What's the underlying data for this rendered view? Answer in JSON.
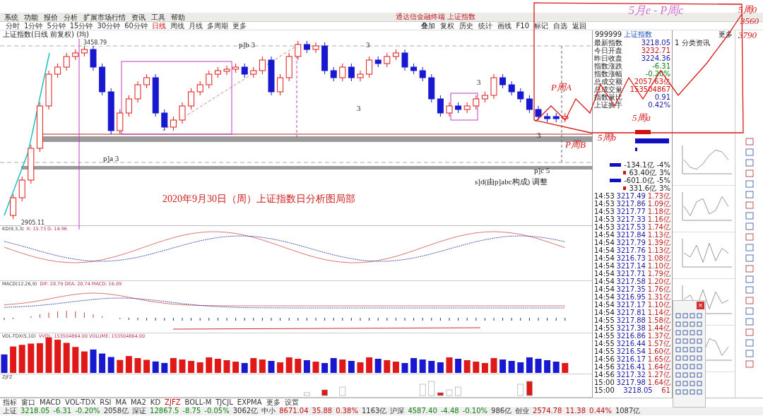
{
  "menu": [
    "系统",
    "功能",
    "报价",
    "分析",
    "扩展市场行情",
    "资讯",
    "工具",
    "帮助"
  ],
  "window_title": "通达信金融终端 上证指数",
  "period_tabs": [
    {
      "label": "分时",
      "selected": false
    },
    {
      "label": "1分钟",
      "selected": false
    },
    {
      "label": "5分钟",
      "selected": false
    },
    {
      "label": "15分钟",
      "selected": false
    },
    {
      "label": "30分钟",
      "selected": false
    },
    {
      "label": "60分钟",
      "selected": false
    },
    {
      "label": "日线",
      "selected": true
    },
    {
      "label": "周线",
      "selected": false
    },
    {
      "label": "月线",
      "selected": false
    },
    {
      "label": "多周期",
      "selected": false
    },
    {
      "label": "更多",
      "selected": false
    }
  ],
  "toolbar_buttons": [
    "叠加",
    "复权",
    "历史",
    "统计",
    "画线",
    "F10",
    "标记",
    "自选",
    "返回"
  ],
  "chart": {
    "title": "上证指数(日线 前复权) (均)",
    "high_label": "3458.79",
    "low_label": "2905.11",
    "wave_labels": [
      "p]b 3",
      "3",
      "3",
      "3",
      "p]a 3",
      "p]c 5",
      "3"
    ],
    "caption": "2020年9月30日（周）上证指数日分析图局部",
    "note": "s]d(由p]abc构成) 调整"
  },
  "indicators": [
    {
      "kind": "kd",
      "name": "KD(9,3,3)",
      "values": "K: 15.73  D: 14.96"
    },
    {
      "kind": "macd",
      "name": "MACD(12,26,9)",
      "values": "DIF: 28.79  DEA: 20.74  MACD: 16.09"
    },
    {
      "kind": "vol",
      "name": "VOL-TDX(5,10)",
      "values": "VVOL: 153504864.00  VOLUME: 153504864.00"
    },
    {
      "kind": "zjfz",
      "name": "ZJFZ"
    }
  ],
  "quote": {
    "code": "999999",
    "name": "上证指数",
    "rows": [
      {
        "label": "最新指数",
        "value": "3218.05",
        "color": "#1a1aa6"
      },
      {
        "label": "今日开盘",
        "value": "3232.71",
        "color": "#d01010"
      },
      {
        "label": "昨日收盘",
        "value": "3224.36",
        "color": "#1a1aa6"
      },
      {
        "label": "指数涨跌",
        "value": "-6.31",
        "color": "#108010"
      },
      {
        "label": "指数涨幅",
        "value": "-0.20%",
        "color": "#108010"
      },
      {
        "label": "总成交额",
        "value": "2057.63亿",
        "color": "#d01010"
      },
      {
        "label": "总成交量",
        "value": "153504867",
        "color": "#d01010"
      },
      {
        "label": "指数量比",
        "value": "0.91",
        "color": "#1a1aa6"
      },
      {
        "label": "上证换手",
        "value": "0.42%",
        "color": "#1a1aa6"
      }
    ],
    "flows": [
      {
        "value": "-134.1亿",
        "pct": "-4%",
        "color": "#1010c0"
      },
      {
        "value": "63.40亿",
        "pct": "3%",
        "color": "#d01010"
      },
      {
        "value": "-601.0亿",
        "pct": "-5%",
        "color": "#1010c0"
      },
      {
        "value": "331.6亿",
        "pct": "3%",
        "color": "#d01010"
      }
    ]
  },
  "ticks": [
    {
      "time": "14:53",
      "price": "3217.49",
      "amount": "1.73亿"
    },
    {
      "time": "14:53",
      "price": "3217.86",
      "amount": "1.09亿"
    },
    {
      "time": "14:53",
      "price": "3217.77",
      "amount": "1.18亿"
    },
    {
      "time": "14:53",
      "price": "3217.33",
      "amount": "1.16亿"
    },
    {
      "time": "14:53",
      "price": "3217.53",
      "amount": "1.74亿"
    },
    {
      "time": "14:54",
      "price": "3217.84",
      "amount": "1.13亿"
    },
    {
      "time": "14:54",
      "price": "3217.79",
      "amount": "1.39亿"
    },
    {
      "time": "14:54",
      "price": "3217.76",
      "amount": "1.13亿"
    },
    {
      "time": "14:54",
      "price": "3216.73",
      "amount": "1.08亿"
    },
    {
      "time": "14:54",
      "price": "3217.14",
      "amount": "1.10亿"
    },
    {
      "time": "14:54",
      "price": "3217.71",
      "amount": "1.79亿"
    },
    {
      "time": "14:54",
      "price": "3217.58",
      "amount": "1.20亿"
    },
    {
      "time": "14:54",
      "price": "3217.35",
      "amount": "1.76亿"
    },
    {
      "time": "14:54",
      "price": "3216.95",
      "amount": "1.31亿"
    },
    {
      "time": "14:54",
      "price": "3217.17",
      "amount": "1.10亿"
    },
    {
      "time": "14:54",
      "price": "3217.81",
      "amount": "1.14亿"
    },
    {
      "time": "14:55",
      "price": "3217.88",
      "amount": "1.58亿"
    },
    {
      "time": "14:55",
      "price": "3217.38",
      "amount": "1.44亿"
    },
    {
      "time": "14:55",
      "price": "3216.86",
      "amount": "1.37亿"
    },
    {
      "time": "14:55",
      "price": "3216.44",
      "amount": "1.57亿"
    },
    {
      "time": "14:55",
      "price": "3216.54",
      "amount": "1.60亿"
    },
    {
      "time": "14:56",
      "price": "3216.17",
      "amount": "1.65亿"
    },
    {
      "time": "14:56",
      "price": "3216.41",
      "amount": "1.64亿"
    },
    {
      "time": "14:56",
      "price": "3217.32",
      "amount": "1.27亿"
    },
    {
      "time": "15:00",
      "price": "3217.98",
      "amount": "1.64亿"
    },
    {
      "time": "15:00",
      "price": "3218.05",
      "amount": "61"
    }
  ],
  "news": {
    "more": "更多",
    "category": "1 分类资讯"
  },
  "palette": {
    "close": "×"
  },
  "bottom_tabs": [
    {
      "label": "指标",
      "selected": false
    },
    {
      "label": "窗口",
      "selected": false
    },
    {
      "label": "MACD",
      "selected": false
    },
    {
      "label": "VOL-TDX",
      "selected": false
    },
    {
      "label": "RSI",
      "selected": false
    },
    {
      "label": "MA",
      "selected": false
    },
    {
      "label": "MA2",
      "selected": false
    },
    {
      "label": "KD",
      "selected": false
    },
    {
      "label": "ZJFZ",
      "selected": true
    },
    {
      "label": "BOLL-M",
      "selected": false
    },
    {
      "label": "TJCJL",
      "selected": false
    },
    {
      "label": "EXPMA",
      "selected": false
    },
    {
      "label": "更多",
      "selected": false
    },
    {
      "label": "设置",
      "selected": false
    }
  ],
  "status": [
    {
      "name": "上证",
      "value": "3218.05",
      "change": "-6.31",
      "pct": "-0.20%",
      "amount": "2058亿"
    },
    {
      "name": "深证",
      "value": "12867.5",
      "change": "-8.75",
      "pct": "-0.05%",
      "amount": "3062亿"
    },
    {
      "name": "中小",
      "value": "8671.04",
      "change": "35.88",
      "pct": "0.38%",
      "amount": "1163亿"
    },
    {
      "name": "沪深",
      "value": "4587.40",
      "change": "-4.48",
      "pct": "-0.10%",
      "amount": "986亿"
    },
    {
      "name": "创业",
      "value": "2574.78",
      "change": "11.38",
      "pct": "0.44%",
      "amount": "1087亿"
    }
  ],
  "handwriting": [
    "5月e - P周c",
    "5周0",
    "3560",
    "3790",
    "P周A",
    "5周a",
    "5周b",
    "P周B"
  ]
}
